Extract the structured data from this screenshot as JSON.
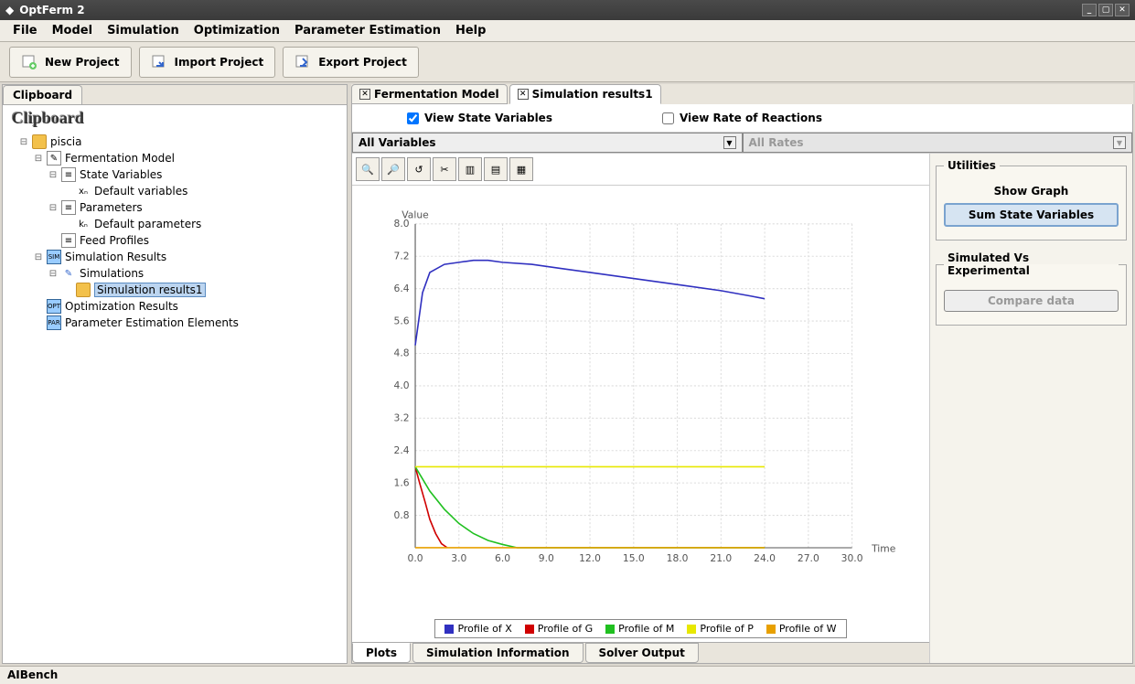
{
  "window": {
    "title": "OptFerm 2"
  },
  "menubar": [
    "File",
    "Model",
    "Simulation",
    "Optimization",
    "Parameter Estimation",
    "Help"
  ],
  "toolbar": {
    "new_project": "New Project",
    "import_project": "Import Project",
    "export_project": "Export Project"
  },
  "left_panel": {
    "tab": "Clipboard",
    "heading": "Clipboard",
    "tree": {
      "root": "piscia",
      "model": "Fermentation Model",
      "state_vars": "State Variables",
      "default_vars": "Default variables",
      "params": "Parameters",
      "default_params": "Default parameters",
      "feed": "Feed Profiles",
      "sim_results": "Simulation Results",
      "simulations": "Simulations",
      "sim_res1": "Simulation results1",
      "opt_results": "Optimization Results",
      "param_est": "Parameter Estimation Elements"
    }
  },
  "right_tabs": {
    "tab1": "Fermentation Model",
    "tab2": "Simulation results1"
  },
  "checks": {
    "state": "View State Variables",
    "rate": "View Rate of Reactions"
  },
  "dropdowns": {
    "vars": "All Variables",
    "rates": "All Rates"
  },
  "utilities": {
    "title": "Utilities",
    "show_graph": "Show Graph",
    "sum_state": "Sum State Variables",
    "sim_vs_exp": "Simulated Vs Experimental",
    "compare": "Compare data"
  },
  "bottom_tabs": [
    "Plots",
    "Simulation Information",
    "Solver Output"
  ],
  "status": "AIBench",
  "chart_data": {
    "type": "line",
    "title": "",
    "xlabel": "Time",
    "ylabel": "Value",
    "xlim": [
      0,
      30
    ],
    "ylim": [
      0,
      8
    ],
    "xticks": [
      0.0,
      3.0,
      6.0,
      9.0,
      12.0,
      15.0,
      18.0,
      21.0,
      24.0,
      27.0,
      30.0
    ],
    "yticks": [
      0.8,
      1.6,
      2.4,
      3.2,
      4.0,
      4.8,
      5.6,
      6.4,
      7.2,
      8.0
    ],
    "series": [
      {
        "name": "Profile of X",
        "color": "#3030c0",
        "x": [
          0,
          0.5,
          1,
          2,
          3,
          4,
          5,
          6,
          8,
          10,
          12,
          15,
          18,
          21,
          23,
          24
        ],
        "y": [
          5.0,
          6.3,
          6.8,
          7.0,
          7.05,
          7.1,
          7.1,
          7.05,
          7.0,
          6.9,
          6.8,
          6.65,
          6.5,
          6.35,
          6.22,
          6.15
        ]
      },
      {
        "name": "Profile of G",
        "color": "#d00000",
        "x": [
          0,
          0.3,
          0.7,
          1.0,
          1.4,
          1.8,
          2.2
        ],
        "y": [
          2.0,
          1.6,
          1.1,
          0.7,
          0.35,
          0.1,
          0.0
        ]
      },
      {
        "name": "Profile of M",
        "color": "#20c020",
        "x": [
          0,
          0.5,
          1,
          2,
          3,
          4,
          5,
          6,
          7,
          24
        ],
        "y": [
          2.0,
          1.7,
          1.4,
          0.95,
          0.6,
          0.35,
          0.18,
          0.08,
          0.0,
          0.0
        ]
      },
      {
        "name": "Profile of P",
        "color": "#e8e800",
        "x": [
          0,
          24
        ],
        "y": [
          2.0,
          2.0
        ]
      },
      {
        "name": "Profile of W",
        "color": "#e8a000",
        "x": [
          0,
          24
        ],
        "y": [
          0.0,
          0.0
        ]
      }
    ]
  }
}
